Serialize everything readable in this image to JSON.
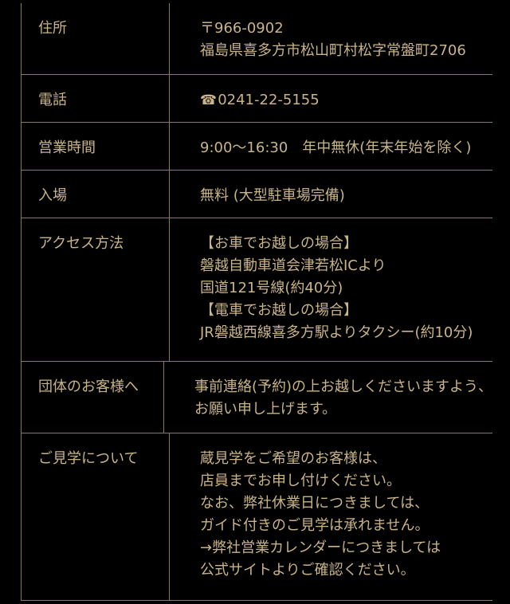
{
  "rows": [
    {
      "label": "住所",
      "lines": [
        "〒966-0902",
        "福島県喜多方市松山町村松字常盤町2706"
      ]
    },
    {
      "label": "電話",
      "phone_icon": "☎",
      "lines": [
        "0241-22-5155"
      ]
    },
    {
      "label": "営業時間",
      "lines": [
        "9:00〜16:30　年中無休(年末年始を除く)"
      ]
    },
    {
      "label": "入場",
      "lines": [
        "無料 (大型駐車場完備)"
      ]
    },
    {
      "label": "アクセス方法",
      "lines": [
        "【お車でお越しの場合】",
        "磐越自動車道会津若松ICより",
        "国道121号線(約40分)",
        "【電車でお越しの場合】",
        "JR磐越西線喜多方駅よりタクシー(約10分)"
      ]
    },
    {
      "label": "団体のお客様へ",
      "lines": [
        "事前連絡(予約)の上お越しくださいますよう、",
        "お願い申し上げます。"
      ]
    },
    {
      "label": "ご見学について",
      "lines": [
        "蔵見学をご希望のお客様は、",
        "店員までお申し付けください。",
        "なお、弊社休業日につきましては、",
        "ガイド付きのご見学は承れません。",
        "→弊社営業カレンダーにつきましては",
        "公式サイトよりご確認ください。"
      ]
    }
  ],
  "colors": {
    "background": "#000000",
    "text": "#c9b486",
    "border": "#8c7a55"
  }
}
